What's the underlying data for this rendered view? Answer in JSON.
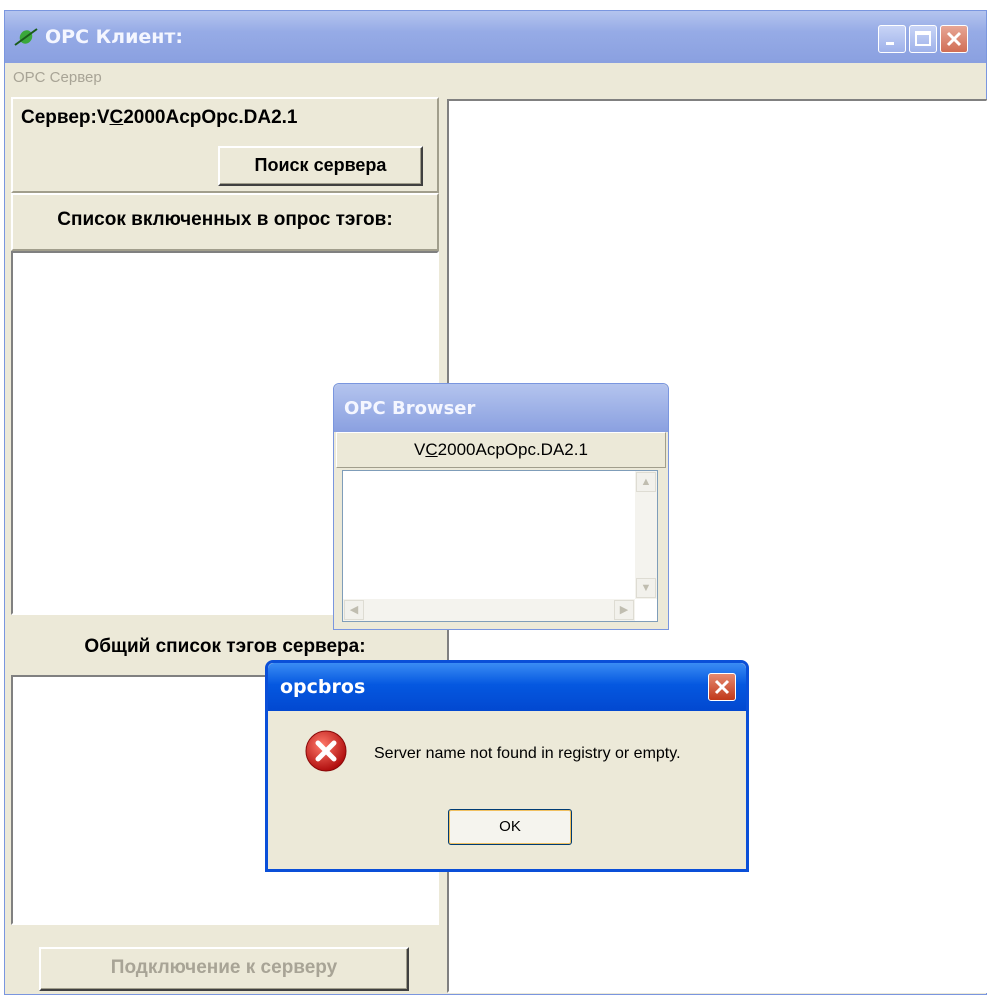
{
  "main_window": {
    "title": "OPC Клиент:",
    "menu": [
      "OPC Сервер"
    ],
    "server_prefix": "Сервер:V",
    "server_hotkey": "C",
    "server_suffix": "2000AcpOpc.DA2.1",
    "search_button": "Поиск сервера",
    "active_tags_label": "Список включенных в опрос тэгов:",
    "all_tags_label": "Общий список тэгов сервера:",
    "connect_button": "Подключение к серверу"
  },
  "browser_window": {
    "title": "OPC Browser",
    "server_prefix": "V",
    "server_hotkey": "C",
    "server_suffix": "2000AcpOpc.DA2.1"
  },
  "dialog": {
    "title": "opcbros",
    "message": "Server name not found in registry or empty.",
    "ok_button": "OK"
  },
  "colors": {
    "title_bar": "#8aa0e0",
    "dialog_title": "#0558e0",
    "window_bg": "#ece9d8"
  },
  "icons": [
    "app-icon",
    "minimize-icon",
    "maximize-icon",
    "close-icon",
    "error-icon",
    "scroll-up-icon",
    "scroll-down-icon",
    "scroll-left-icon",
    "scroll-right-icon"
  ]
}
